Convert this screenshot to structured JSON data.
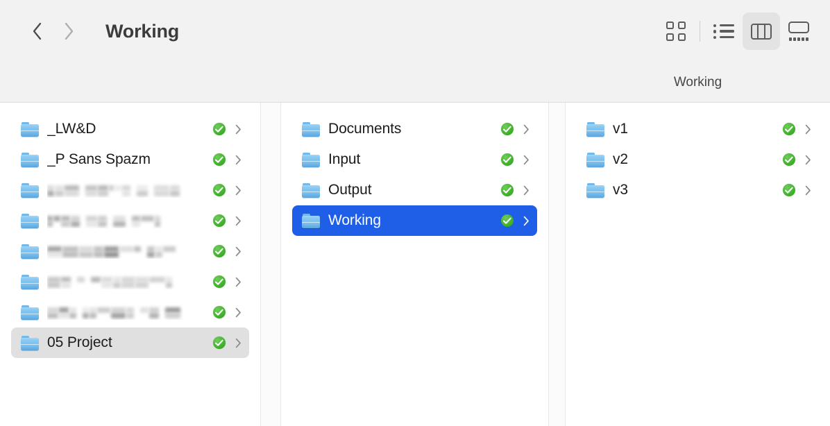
{
  "window": {
    "title": "Working",
    "background_color": "#f2f2f2",
    "panel_color": "#ffffff"
  },
  "toolbar": {
    "back_label": "Back",
    "back_icon": "chevron-left-icon",
    "forward_label": "Forward",
    "forward_icon": "chevron-right-icon",
    "title": "Working",
    "view_modes": [
      {
        "id": "icon",
        "label": "Icon View",
        "icon": "icon-grid-icon",
        "active": false
      },
      {
        "id": "list",
        "label": "List View",
        "icon": "list-icon",
        "active": false
      },
      {
        "id": "column",
        "label": "Column View",
        "icon": "columns-icon",
        "active": true
      },
      {
        "id": "gallery",
        "label": "Gallery View",
        "icon": "gallery-icon",
        "active": false
      }
    ]
  },
  "header": {
    "column3_label": "Working"
  },
  "colors": {
    "selection_active": "#1f5fe8",
    "selection_inactive": "#e0e0e0",
    "sync_badge_green": "#37ab26",
    "folder_blue": "#79c0f0",
    "text_primary": "#1b1b1b",
    "text_selected": "#ffffff",
    "divider": "#e8e8e8"
  },
  "columns": [
    {
      "id": "column-1",
      "items": [
        {
          "name": "_LW&D",
          "redacted": false,
          "selected": "none",
          "badge": "sync-complete-badge",
          "chevron": "disclosure-chevron-icon"
        },
        {
          "name": "_P Sans Spazm",
          "redacted": false,
          "selected": "none",
          "badge": "sync-complete-badge",
          "chevron": "disclosure-chevron-icon"
        },
        {
          "name": "",
          "redacted": true,
          "selected": "none",
          "badge": "sync-complete-badge",
          "chevron": "disclosure-chevron-icon"
        },
        {
          "name": "",
          "redacted": true,
          "selected": "none",
          "badge": "sync-complete-badge",
          "chevron": "disclosure-chevron-icon"
        },
        {
          "name": "",
          "redacted": true,
          "selected": "none",
          "badge": "sync-complete-badge",
          "chevron": "disclosure-chevron-icon"
        },
        {
          "name": "",
          "redacted": true,
          "selected": "none",
          "badge": "sync-complete-badge",
          "chevron": "disclosure-chevron-icon"
        },
        {
          "name": "",
          "redacted": true,
          "selected": "none",
          "badge": "sync-complete-badge",
          "chevron": "disclosure-chevron-icon"
        },
        {
          "name": "05 Project",
          "redacted": false,
          "selected": "inactive",
          "badge": "sync-complete-badge",
          "chevron": "disclosure-chevron-icon"
        }
      ]
    },
    {
      "id": "column-2",
      "items": [
        {
          "name": "Documents",
          "redacted": false,
          "selected": "none",
          "badge": "sync-complete-badge",
          "chevron": "disclosure-chevron-icon"
        },
        {
          "name": "Input",
          "redacted": false,
          "selected": "none",
          "badge": "sync-complete-badge",
          "chevron": "disclosure-chevron-icon"
        },
        {
          "name": "Output",
          "redacted": false,
          "selected": "none",
          "badge": "sync-complete-badge",
          "chevron": "disclosure-chevron-icon"
        },
        {
          "name": "Working",
          "redacted": false,
          "selected": "active",
          "badge": "sync-complete-badge",
          "chevron": "disclosure-chevron-icon"
        }
      ]
    },
    {
      "id": "column-3",
      "items": [
        {
          "name": "v1",
          "redacted": false,
          "selected": "none",
          "badge": "sync-complete-badge",
          "chevron": "disclosure-chevron-icon"
        },
        {
          "name": "v2",
          "redacted": false,
          "selected": "none",
          "badge": "sync-complete-badge",
          "chevron": "disclosure-chevron-icon"
        },
        {
          "name": "v3",
          "redacted": false,
          "selected": "none",
          "badge": "sync-complete-badge",
          "chevron": "disclosure-chevron-icon"
        }
      ]
    }
  ]
}
